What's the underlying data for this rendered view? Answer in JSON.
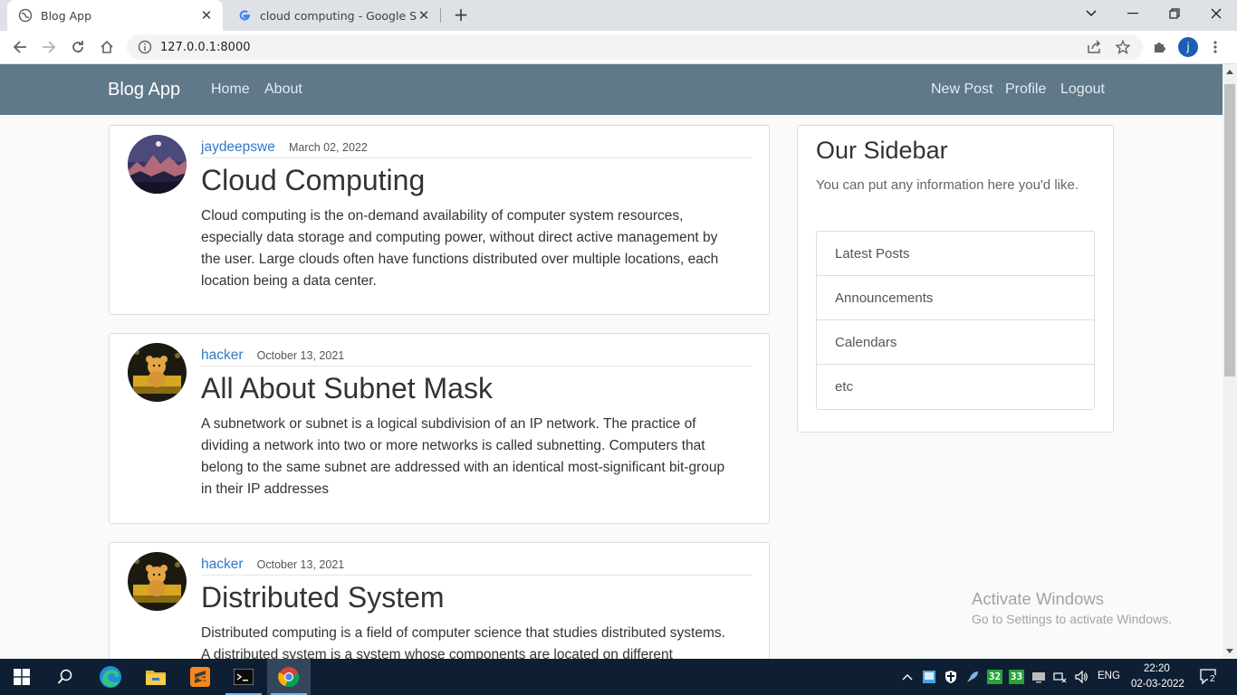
{
  "browser": {
    "tabs": [
      {
        "title": "Blog App",
        "active": true
      },
      {
        "title": "cloud computing - Google Search",
        "active": false
      }
    ],
    "url": "127.0.0.1:8000",
    "profile_initial": "j"
  },
  "navbar": {
    "brand": "Blog App",
    "left_links": [
      "Home",
      "About"
    ],
    "right_links": [
      "New Post",
      "Profile",
      "Logout"
    ]
  },
  "posts": [
    {
      "author": "jaydeepswe",
      "date": "March 02, 2022",
      "title": "Cloud Computing",
      "body_lines": [
        "Cloud computing is the on-demand availability of computer system resources,",
        "especially data storage and computing power, without direct active management by",
        "the user. Large clouds often have functions distributed over multiple locations, each",
        "location being a data center."
      ]
    },
    {
      "author": "hacker",
      "date": "October 13, 2021",
      "title": "All About Subnet Mask",
      "body_lines": [
        "A subnetwork or subnet is a logical subdivision of an IP network. The practice of",
        "dividing a network into two or more networks is called subnetting. Computers that",
        "belong to the same subnet are addressed with an identical most-significant bit-group",
        "in their IP addresses"
      ]
    },
    {
      "author": "hacker",
      "date": "October 13, 2021",
      "title": "Distributed System",
      "body_lines": [
        "Distributed computing is a field of computer science that studies distributed systems.",
        "A distributed system is a system whose components are located on different"
      ]
    }
  ],
  "sidebar": {
    "title": "Our Sidebar",
    "description": "You can put any information here you'd like.",
    "items": [
      "Latest Posts",
      "Announcements",
      "Calendars",
      "etc"
    ]
  },
  "watermark": {
    "line1": "Activate Windows",
    "line2": "Go to Settings to activate Windows."
  },
  "taskbar": {
    "apps": [
      "start-icon",
      "search-icon",
      "edge-icon",
      "file-explorer-icon",
      "sublime-text-icon",
      "terminal-icon",
      "chrome-icon"
    ],
    "tray_badges": [
      "32",
      "33"
    ],
    "language": "ENG",
    "time": "22:20",
    "date": "02-03-2022",
    "notification_count": "2"
  },
  "colors": {
    "navbar": "#5f788a",
    "link": "#2f7ac9",
    "taskbar": "#0f1f33"
  }
}
